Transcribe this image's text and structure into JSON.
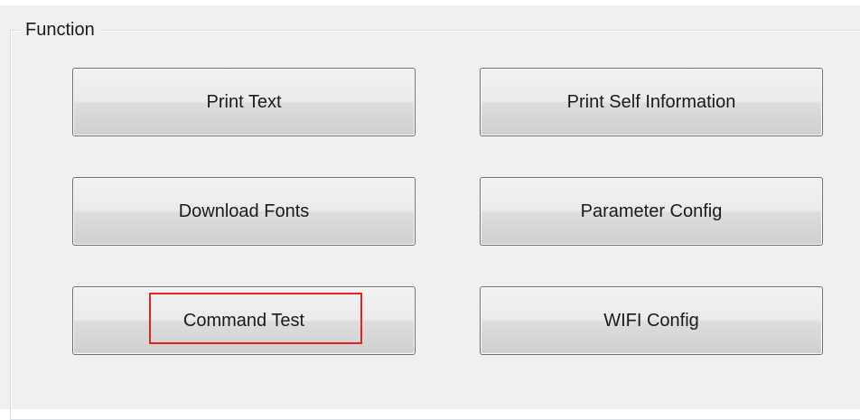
{
  "group": {
    "title": "Function"
  },
  "buttons": {
    "print_text": "Print Text",
    "print_self_information": "Print Self Information",
    "download_fonts": "Download Fonts",
    "parameter_config": "Parameter Config",
    "command_test": "Command Test",
    "wifi_config": "WIFI Config"
  },
  "annotation": {
    "highlight_color": "#e52222",
    "highlighted_button": "Command Test"
  },
  "colors": {
    "window_bg": "#f0f0f0",
    "button_border": "#707070",
    "groupbox_border": "#d5dfe5"
  }
}
